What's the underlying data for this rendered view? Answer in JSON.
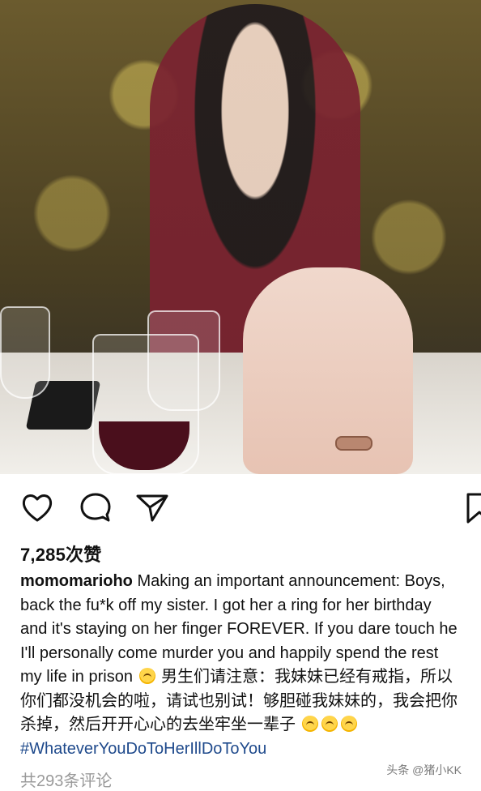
{
  "post": {
    "likes_text": "7,285次赞",
    "username": "momomarioho",
    "caption_lines": [
      " Making an important announcement: Boys,",
      "back the fu*k off my sister. I got her a ring for her birthday",
      "and it's staying on her finger FOREVER. If you dare touch he",
      "I'll personally come murder you and happily spend the rest",
      "my life in prison ",
      " 男生们请注意：我妹妹已经有戒指，所以",
      "你们都没机会的啦，请试也别试！够胆碰我妹妹的，我会把你",
      "杀掉，然后开开心心的去坐牢坐一辈子 "
    ],
    "hashtag": "#WhateverYouDoToHerIllDoToYou",
    "comments_text": "共293条评论"
  },
  "watermark": "头条 @猪小KK",
  "icons": {
    "like": "heart-icon",
    "comment": "comment-bubble-icon",
    "share": "send-arrow-icon",
    "save": "bookmark-icon",
    "emoji": "upside-down-smile-emoji"
  },
  "colors": {
    "hashtag": "#1f4a8c",
    "comments": "#9a9a9a"
  }
}
